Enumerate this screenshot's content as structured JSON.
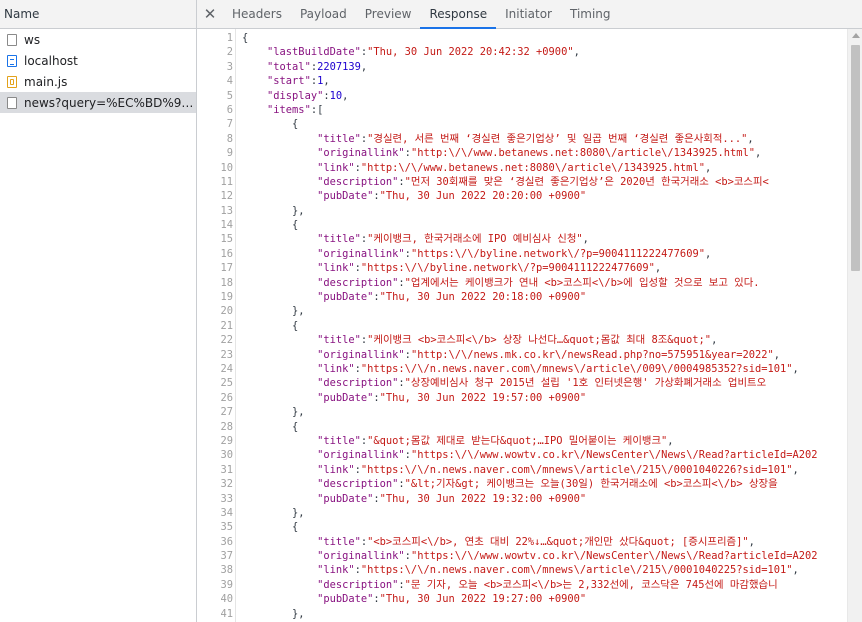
{
  "left_panel": {
    "header": "Name",
    "requests": [
      {
        "name": "ws",
        "type": "other",
        "selected": false
      },
      {
        "name": "localhost",
        "type": "document",
        "selected": false
      },
      {
        "name": "main.js",
        "type": "script",
        "selected": false
      },
      {
        "name": "news?query=%EC%BD%94%E...",
        "type": "other",
        "selected": true
      }
    ]
  },
  "tabs": {
    "close_icon": "close-icon",
    "items": [
      "Headers",
      "Payload",
      "Preview",
      "Response",
      "Initiator",
      "Timing"
    ],
    "active": "Response"
  },
  "response": {
    "lines": [
      {
        "n": 1,
        "ind": 0,
        "seg": [
          {
            "c": "p",
            "t": "{"
          }
        ]
      },
      {
        "n": 2,
        "ind": 4,
        "seg": [
          {
            "c": "k",
            "t": "\"lastBuildDate\""
          },
          {
            "c": "p",
            "t": ":"
          },
          {
            "c": "s",
            "t": "\"Thu, 30 Jun 2022 20:42:32 +0900\""
          },
          {
            "c": "p",
            "t": ","
          }
        ]
      },
      {
        "n": 3,
        "ind": 4,
        "seg": [
          {
            "c": "k",
            "t": "\"total\""
          },
          {
            "c": "p",
            "t": ":"
          },
          {
            "c": "n",
            "t": "2207139"
          },
          {
            "c": "p",
            "t": ","
          }
        ]
      },
      {
        "n": 4,
        "ind": 4,
        "seg": [
          {
            "c": "k",
            "t": "\"start\""
          },
          {
            "c": "p",
            "t": ":"
          },
          {
            "c": "n",
            "t": "1"
          },
          {
            "c": "p",
            "t": ","
          }
        ]
      },
      {
        "n": 5,
        "ind": 4,
        "seg": [
          {
            "c": "k",
            "t": "\"display\""
          },
          {
            "c": "p",
            "t": ":"
          },
          {
            "c": "n",
            "t": "10"
          },
          {
            "c": "p",
            "t": ","
          }
        ]
      },
      {
        "n": 6,
        "ind": 4,
        "seg": [
          {
            "c": "k",
            "t": "\"items\""
          },
          {
            "c": "p",
            "t": ":["
          }
        ]
      },
      {
        "n": 7,
        "ind": 8,
        "seg": [
          {
            "c": "p",
            "t": "{"
          }
        ]
      },
      {
        "n": 8,
        "ind": 12,
        "seg": [
          {
            "c": "k",
            "t": "\"title\""
          },
          {
            "c": "p",
            "t": ":"
          },
          {
            "c": "s",
            "t": "\"경실련, 서른 번째 ‘경실련 좋은기업상’ 및 일곱 번째 ‘경실련 좋은사회적...\""
          },
          {
            "c": "p",
            "t": ","
          }
        ]
      },
      {
        "n": 9,
        "ind": 12,
        "seg": [
          {
            "c": "k",
            "t": "\"originallink\""
          },
          {
            "c": "p",
            "t": ":"
          },
          {
            "c": "s",
            "t": "\"http:\\/\\/www.betanews.net:8080\\/article\\/1343925.html\""
          },
          {
            "c": "p",
            "t": ","
          }
        ]
      },
      {
        "n": 10,
        "ind": 12,
        "seg": [
          {
            "c": "k",
            "t": "\"link\""
          },
          {
            "c": "p",
            "t": ":"
          },
          {
            "c": "s",
            "t": "\"http:\\/\\/www.betanews.net:8080\\/article\\/1343925.html\""
          },
          {
            "c": "p",
            "t": ","
          }
        ]
      },
      {
        "n": 11,
        "ind": 12,
        "seg": [
          {
            "c": "k",
            "t": "\"description\""
          },
          {
            "c": "p",
            "t": ":"
          },
          {
            "c": "s",
            "t": "\"먼저 30회째를 맞은 ‘경실련 좋은기업상’은 2020년 한국거래소 <b>코스피<"
          }
        ]
      },
      {
        "n": 12,
        "ind": 12,
        "seg": [
          {
            "c": "k",
            "t": "\"pubDate\""
          },
          {
            "c": "p",
            "t": ":"
          },
          {
            "c": "s",
            "t": "\"Thu, 30 Jun 2022 20:20:00 +0900\""
          }
        ]
      },
      {
        "n": 13,
        "ind": 8,
        "seg": [
          {
            "c": "p",
            "t": "},"
          }
        ]
      },
      {
        "n": 14,
        "ind": 8,
        "seg": [
          {
            "c": "p",
            "t": "{"
          }
        ]
      },
      {
        "n": 15,
        "ind": 12,
        "seg": [
          {
            "c": "k",
            "t": "\"title\""
          },
          {
            "c": "p",
            "t": ":"
          },
          {
            "c": "s",
            "t": "\"케이뱅크, 한국거래소에 IPO 예비심사 신청\""
          },
          {
            "c": "p",
            "t": ","
          }
        ]
      },
      {
        "n": 16,
        "ind": 12,
        "seg": [
          {
            "c": "k",
            "t": "\"originallink\""
          },
          {
            "c": "p",
            "t": ":"
          },
          {
            "c": "s",
            "t": "\"https:\\/\\/byline.network\\/?p=9004111222477609\""
          },
          {
            "c": "p",
            "t": ","
          }
        ]
      },
      {
        "n": 17,
        "ind": 12,
        "seg": [
          {
            "c": "k",
            "t": "\"link\""
          },
          {
            "c": "p",
            "t": ":"
          },
          {
            "c": "s",
            "t": "\"https:\\/\\/byline.network\\/?p=9004111222477609\""
          },
          {
            "c": "p",
            "t": ","
          }
        ]
      },
      {
        "n": 18,
        "ind": 12,
        "seg": [
          {
            "c": "k",
            "t": "\"description\""
          },
          {
            "c": "p",
            "t": ":"
          },
          {
            "c": "s",
            "t": "\"업계에서는 케이뱅크가 연내 <b>코스피<\\/b>에 입성할 것으로 보고 있다."
          }
        ]
      },
      {
        "n": 19,
        "ind": 12,
        "seg": [
          {
            "c": "k",
            "t": "\"pubDate\""
          },
          {
            "c": "p",
            "t": ":"
          },
          {
            "c": "s",
            "t": "\"Thu, 30 Jun 2022 20:18:00 +0900\""
          }
        ]
      },
      {
        "n": 20,
        "ind": 8,
        "seg": [
          {
            "c": "p",
            "t": "},"
          }
        ]
      },
      {
        "n": 21,
        "ind": 8,
        "seg": [
          {
            "c": "p",
            "t": "{"
          }
        ]
      },
      {
        "n": 22,
        "ind": 12,
        "seg": [
          {
            "c": "k",
            "t": "\"title\""
          },
          {
            "c": "p",
            "t": ":"
          },
          {
            "c": "s",
            "t": "\"케이뱅크 <b>코스피<\\/b> 상장 나선다…&quot;몸값 최대 8조&quot;\""
          },
          {
            "c": "p",
            "t": ","
          }
        ]
      },
      {
        "n": 23,
        "ind": 12,
        "seg": [
          {
            "c": "k",
            "t": "\"originallink\""
          },
          {
            "c": "p",
            "t": ":"
          },
          {
            "c": "s",
            "t": "\"http:\\/\\/news.mk.co.kr\\/newsRead.php?no=575951&year=2022\""
          },
          {
            "c": "p",
            "t": ","
          }
        ]
      },
      {
        "n": 24,
        "ind": 12,
        "seg": [
          {
            "c": "k",
            "t": "\"link\""
          },
          {
            "c": "p",
            "t": ":"
          },
          {
            "c": "s",
            "t": "\"https:\\/\\/n.news.naver.com\\/mnews\\/article\\/009\\/0004985352?sid=101\""
          },
          {
            "c": "p",
            "t": ","
          }
        ]
      },
      {
        "n": 25,
        "ind": 12,
        "seg": [
          {
            "c": "k",
            "t": "\"description\""
          },
          {
            "c": "p",
            "t": ":"
          },
          {
            "c": "s",
            "t": "\"상장예비심사 청구 2015년 설립 '1호 인터넷은행' 가상화폐거래소 업비트오"
          }
        ]
      },
      {
        "n": 26,
        "ind": 12,
        "seg": [
          {
            "c": "k",
            "t": "\"pubDate\""
          },
          {
            "c": "p",
            "t": ":"
          },
          {
            "c": "s",
            "t": "\"Thu, 30 Jun 2022 19:57:00 +0900\""
          }
        ]
      },
      {
        "n": 27,
        "ind": 8,
        "seg": [
          {
            "c": "p",
            "t": "},"
          }
        ]
      },
      {
        "n": 28,
        "ind": 8,
        "seg": [
          {
            "c": "p",
            "t": "{"
          }
        ]
      },
      {
        "n": 29,
        "ind": 12,
        "seg": [
          {
            "c": "k",
            "t": "\"title\""
          },
          {
            "c": "p",
            "t": ":"
          },
          {
            "c": "s",
            "t": "\"&quot;몸값 제대로 받는다&quot;…IPO 밀어붙이는 케이뱅크\""
          },
          {
            "c": "p",
            "t": ","
          }
        ]
      },
      {
        "n": 30,
        "ind": 12,
        "seg": [
          {
            "c": "k",
            "t": "\"originallink\""
          },
          {
            "c": "p",
            "t": ":"
          },
          {
            "c": "s",
            "t": "\"https:\\/\\/www.wowtv.co.kr\\/NewsCenter\\/News\\/Read?articleId=A202"
          }
        ]
      },
      {
        "n": 31,
        "ind": 12,
        "seg": [
          {
            "c": "k",
            "t": "\"link\""
          },
          {
            "c": "p",
            "t": ":"
          },
          {
            "c": "s",
            "t": "\"https:\\/\\/n.news.naver.com\\/mnews\\/article\\/215\\/0001040226?sid=101\""
          },
          {
            "c": "p",
            "t": ","
          }
        ]
      },
      {
        "n": 32,
        "ind": 12,
        "seg": [
          {
            "c": "k",
            "t": "\"description\""
          },
          {
            "c": "p",
            "t": ":"
          },
          {
            "c": "s",
            "t": "\"&lt;기자&gt; 케이뱅크는 오늘(30일) 한국거래소에 <b>코스피<\\/b> 상장을"
          }
        ]
      },
      {
        "n": 33,
        "ind": 12,
        "seg": [
          {
            "c": "k",
            "t": "\"pubDate\""
          },
          {
            "c": "p",
            "t": ":"
          },
          {
            "c": "s",
            "t": "\"Thu, 30 Jun 2022 19:32:00 +0900\""
          }
        ]
      },
      {
        "n": 34,
        "ind": 8,
        "seg": [
          {
            "c": "p",
            "t": "},"
          }
        ]
      },
      {
        "n": 35,
        "ind": 8,
        "seg": [
          {
            "c": "p",
            "t": "{"
          }
        ]
      },
      {
        "n": 36,
        "ind": 12,
        "seg": [
          {
            "c": "k",
            "t": "\"title\""
          },
          {
            "c": "p",
            "t": ":"
          },
          {
            "c": "s",
            "t": "\"<b>코스피<\\/b>, 연초 대비 22%↓…&quot;개인만 샀다&quot; [증시프리즘]\""
          },
          {
            "c": "p",
            "t": ","
          }
        ]
      },
      {
        "n": 37,
        "ind": 12,
        "seg": [
          {
            "c": "k",
            "t": "\"originallink\""
          },
          {
            "c": "p",
            "t": ":"
          },
          {
            "c": "s",
            "t": "\"https:\\/\\/www.wowtv.co.kr\\/NewsCenter\\/News\\/Read?articleId=A202"
          }
        ]
      },
      {
        "n": 38,
        "ind": 12,
        "seg": [
          {
            "c": "k",
            "t": "\"link\""
          },
          {
            "c": "p",
            "t": ":"
          },
          {
            "c": "s",
            "t": "\"https:\\/\\/n.news.naver.com\\/mnews\\/article\\/215\\/0001040225?sid=101\""
          },
          {
            "c": "p",
            "t": ","
          }
        ]
      },
      {
        "n": 39,
        "ind": 12,
        "seg": [
          {
            "c": "k",
            "t": "\"description\""
          },
          {
            "c": "p",
            "t": ":"
          },
          {
            "c": "s",
            "t": "\"문 기자, 오늘 <b>코스피<\\/b>는 2,332선에, 코스닥은 745선에 마감했습니"
          }
        ]
      },
      {
        "n": 40,
        "ind": 12,
        "seg": [
          {
            "c": "k",
            "t": "\"pubDate\""
          },
          {
            "c": "p",
            "t": ":"
          },
          {
            "c": "s",
            "t": "\"Thu, 30 Jun 2022 19:27:00 +0900\""
          }
        ]
      },
      {
        "n": 41,
        "ind": 8,
        "seg": [
          {
            "c": "p",
            "t": "},"
          }
        ]
      }
    ]
  },
  "colors": {
    "key": "#881280",
    "string": "#c41a16",
    "number": "#1c00cf",
    "accent": "#1a73e8"
  }
}
